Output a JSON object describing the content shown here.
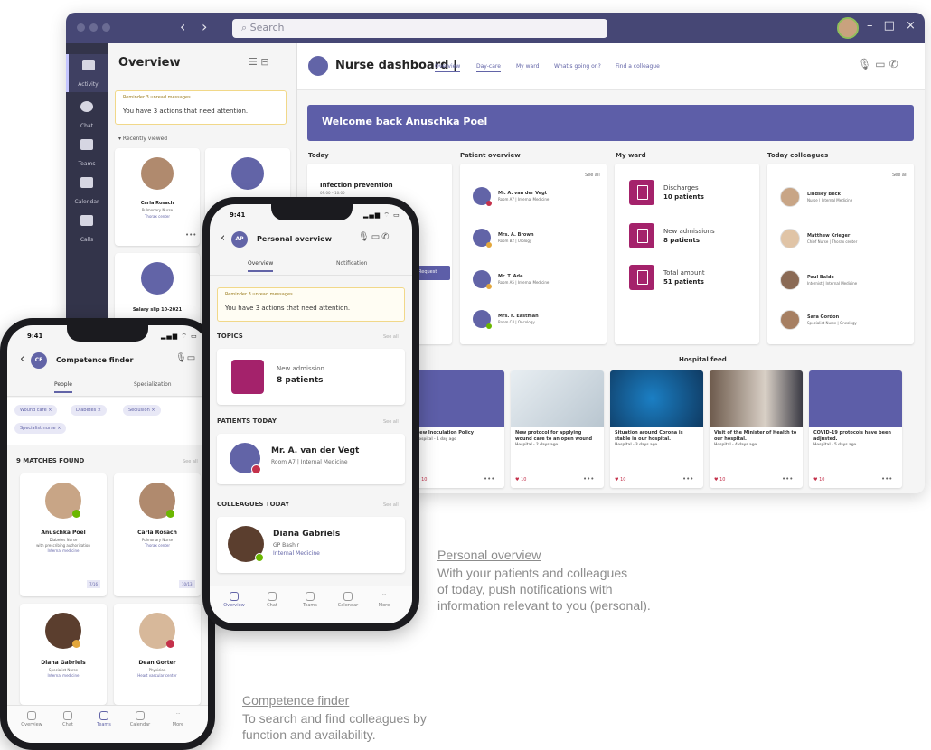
{
  "desktop": {
    "search_placeholder": "Search",
    "window_controls": "– □ ×",
    "rail": [
      "Activity",
      "Chat",
      "Teams",
      "Calendar",
      "Calls"
    ],
    "overview": {
      "title": "Overview",
      "alert_small": "Reminder 3 unread messages",
      "alert_text": "You have 3 actions that need attention.",
      "recently_viewed": "▾ Recently viewed",
      "card1": {
        "name": "Carla Rosach",
        "role": "Pulmonary Nurse",
        "extra": "Thorax center"
      },
      "card2_label": "Salary slip 10-2021"
    },
    "dashboard": {
      "title": "Nurse dashboard |",
      "tabs": [
        "Overview",
        "Day-care",
        "My ward",
        "What's going on?",
        "Find a colleague"
      ],
      "welcome": "Welcome back Anuschka Poel",
      "columns": [
        "Today",
        "Patient overview",
        "My ward",
        "Today colleagues"
      ],
      "today_item": {
        "title": "Infection prevention",
        "time": "09:00 – 10:00",
        "button": "Request"
      },
      "see_all": "See all",
      "patients": [
        {
          "name": "Mr. A. van der Vegt",
          "sub": "Room A7 | Internal Medicine"
        },
        {
          "name": "Mrs. A. Brown",
          "sub": "Room B2 | Urology"
        },
        {
          "name": "Mr. T. Ade",
          "sub": "Room A5 | Internal Medicine"
        },
        {
          "name": "Mrs. F. Eastman",
          "sub": "Room C4 | Oncology"
        }
      ],
      "ward": [
        {
          "label": "Discharges",
          "value": "10 patients"
        },
        {
          "label": "New admissions",
          "value": "8 patients"
        },
        {
          "label": "Total amount",
          "value": "51 patients"
        }
      ],
      "colleagues": [
        {
          "name": "Lindsey Beck",
          "sub": "Nurse | Internal Medicine"
        },
        {
          "name": "Matthew Krieger",
          "sub": "Chief Nurse | Thorax center"
        },
        {
          "name": "Paul Baldo",
          "sub": "Internist | Internal Medicine"
        },
        {
          "name": "Sara Gordon",
          "sub": "Specialist Nurse | Oncology"
        }
      ],
      "hospital_feed": "Hospital feed",
      "feed": [
        {
          "title": "New Inoculation Policy",
          "sub": "Hospital · 1 day ago"
        },
        {
          "title": "New protocol for applying wound care to an open wound",
          "sub": "Hospital · 2 days ago"
        },
        {
          "title": "Situation around Corona is stable in our hospital.",
          "sub": "Hospital · 3 days ago"
        },
        {
          "title": "Visit of the Minister of Health to our hospital.",
          "sub": "Hospital · 4 days ago"
        },
        {
          "title": "COVID-19 protocols have been adjusted.",
          "sub": "Hospital · 5 days ago"
        }
      ]
    }
  },
  "phone_personal": {
    "time": "9:41",
    "status": "▂▄▆ ⌔ ▭",
    "avatar": "AP",
    "title": "Personal overview",
    "tabs": [
      "Overview",
      "Notification"
    ],
    "alert_small": "Reminder 3 unread messages",
    "alert_text": "You have 3 actions that need attention.",
    "topics": "TOPICS",
    "see_all": "See all",
    "topic_label": "New admission",
    "topic_value": "8 patients",
    "patients_today": "PATIENTS TODAY",
    "patient_name": "Mr. A. van der Vegt",
    "patient_sub": "Room A7 | Internal Medicine",
    "colleagues_today": "COLLEAGUES TODAY",
    "colleague_name": "Diana Gabriels",
    "colleague_role": "GP Bashir",
    "colleague_dept": "Internal Medicine",
    "footer": [
      "Overview",
      "Chat",
      "Teams",
      "Calendar",
      "More"
    ]
  },
  "phone_competence": {
    "time": "9:41",
    "status": "▂▄▆ ⌔ ▭",
    "avatar": "CF",
    "title": "Competence finder",
    "tabs": [
      "People",
      "Specialization"
    ],
    "filters": [
      "Wound care ×",
      "Diabetes ×",
      "Seclusion ×",
      "Specialist nurse ×"
    ],
    "matches": "9 MATCHES FOUND",
    "see_all": "See all",
    "people": [
      {
        "name": "Anuschka Poel",
        "role": "Diabetes Nurse",
        "extra": "with prescribing authorization",
        "extra2": "Internal medicine",
        "badge": "7/16"
      },
      {
        "name": "Carla Rosach",
        "role": "Pulmonary Nurse",
        "extra": "Thorax center",
        "extra2": "",
        "badge": "10/13"
      },
      {
        "name": "Diana Gabriels",
        "role": "Specialist Nurse",
        "extra": "Internal medicine",
        "extra2": "",
        "badge": ""
      },
      {
        "name": "Dean Gorter",
        "role": "Physician",
        "extra": "Heart vascular center",
        "extra2": "",
        "badge": ""
      }
    ],
    "footer": [
      "Overview",
      "Chat",
      "Teams",
      "Calendar",
      "More"
    ]
  },
  "captions": {
    "personal_title": "Personal overview",
    "personal_lines": [
      "With your patients and colleagues",
      "of today, push notifications with",
      "information relevant to you (personal)."
    ],
    "competence_title": "Competence finder",
    "competence_lines": [
      "To search and find colleagues by",
      "function and availability."
    ]
  },
  "colors": {
    "brand": "#6264a7",
    "titlebar": "#464775",
    "rail": "#33344a",
    "magenta": "#a4226b",
    "alert_border": "#f1d889"
  }
}
